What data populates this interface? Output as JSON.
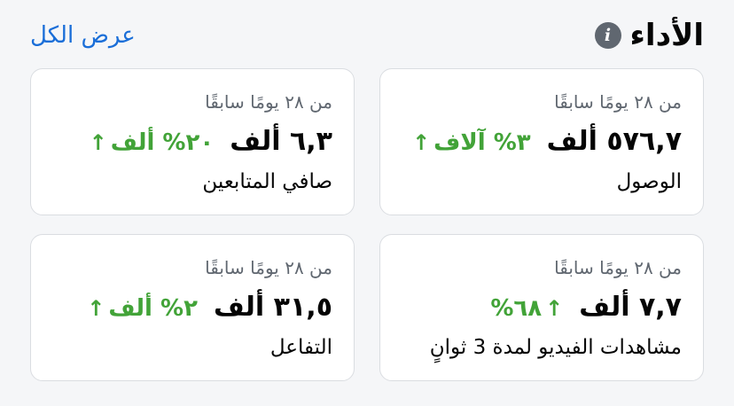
{
  "header": {
    "title": "الأداء",
    "see_all": "عرض الكل"
  },
  "cards": [
    {
      "period": "من ٢٨ يومًا سابقًا",
      "value": "٥٧٦,٧ ألف",
      "change": "٣% آلاف",
      "metric": "الوصول"
    },
    {
      "period": "من ٢٨ يومًا سابقًا",
      "value": "٦,٣ ألف",
      "change": "٢٠% ألف",
      "metric": "صافي المتابعين"
    },
    {
      "period": "من ٢٨ يومًا سابقًا",
      "value": "٧,٧ ألف",
      "change": "٦٨%",
      "metric": "مشاهدات الفيديو لمدة 3 ثوانٍ"
    },
    {
      "period": "من ٢٨ يومًا سابقًا",
      "value": "٣١,٥ ألف",
      "change": "٢% ألف",
      "metric": "التفاعل"
    }
  ],
  "colors": {
    "positive": "#42a338",
    "link": "#1a6ed8"
  },
  "icons": {
    "info": "info-icon",
    "up": "arrow-up-icon"
  }
}
